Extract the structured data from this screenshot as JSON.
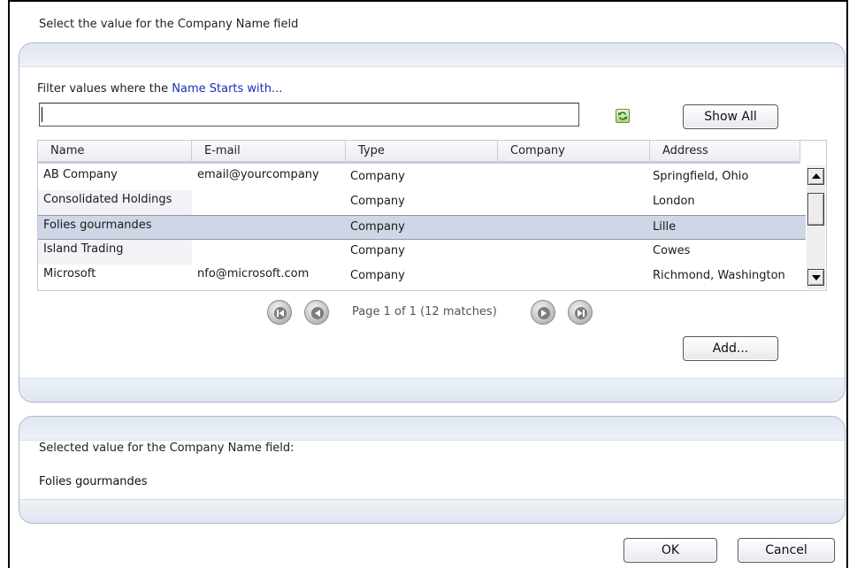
{
  "dialog": {
    "title": "Select the value for the Company Name field"
  },
  "filter": {
    "label_prefix": "Filter values where the",
    "label_field": "Name Starts with...",
    "input_value": "",
    "refresh_icon": "refresh-icon",
    "show_all_label": "Show All"
  },
  "grid": {
    "columns": [
      "Name",
      "E-mail",
      "Type",
      "Company",
      "Address"
    ],
    "rows": [
      {
        "name": "AB Company",
        "email": "email@yourcompany",
        "type": "Company",
        "company": "",
        "address": "Springfield, Ohio"
      },
      {
        "name": "Consolidated Holdings",
        "email": "",
        "type": "Company",
        "company": "",
        "address": "London"
      },
      {
        "name": "Folies gourmandes",
        "email": "",
        "type": "Company",
        "company": "",
        "address": "Lille"
      },
      {
        "name": "Island Trading",
        "email": "",
        "type": "Company",
        "company": "",
        "address": "Cowes"
      },
      {
        "name": "Microsoft",
        "email": "nfo@microsoft.com",
        "type": "Company",
        "company": "",
        "address": "Richmond, Washington"
      }
    ],
    "selected_row": 2
  },
  "pager": {
    "info": "Page 1 of 1 (12 matches)"
  },
  "add_label": "Add...",
  "selection": {
    "label": "Selected value for the Company Name field:",
    "value": "Folies gourmandes"
  },
  "footer": {
    "ok_label": "OK",
    "cancel_label": "Cancel"
  }
}
